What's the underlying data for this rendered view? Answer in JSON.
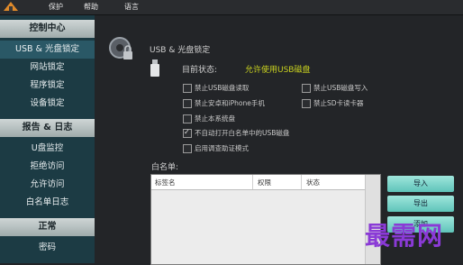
{
  "menu": {
    "items": [
      "保护",
      "帮助",
      "语言"
    ]
  },
  "sidebar": {
    "sections": [
      {
        "title": "控制中心",
        "items": [
          "USB & 光盘锁定",
          "网站锁定",
          "程序锁定",
          "设备锁定"
        ]
      },
      {
        "title": "报告 & 日志",
        "items": [
          "U盘监控",
          "拒绝访问",
          "允许访问",
          "白名单日志"
        ]
      },
      {
        "title": "正常",
        "items": [
          "密码"
        ]
      }
    ]
  },
  "main": {
    "title": "USB & 光盘锁定",
    "status_label": "目前状态:",
    "status_value": "允许使用USB磁盘",
    "options": [
      {
        "label": "禁止USB磁盘读取",
        "checked": false
      },
      {
        "label": "禁止USB磁盘写入",
        "checked": false
      },
      {
        "label": "禁止安卓和iPhone手机",
        "checked": false
      },
      {
        "label": "禁止SD卡读卡器",
        "checked": false
      },
      {
        "label": "禁止本系统盘",
        "checked": false
      },
      {
        "label": "不自动打开白名单中的USB磁盘",
        "checked": true
      },
      {
        "label": "启用调查助证模式",
        "checked": false
      }
    ],
    "whitelist_label": "白名单:",
    "table": {
      "headers": [
        "标签名",
        "权限",
        "状态"
      ]
    },
    "buttons": [
      "导入",
      "导出",
      "添加"
    ]
  },
  "watermark": "最需网",
  "colors": {
    "status_value": "#c9d21f",
    "button": "#6fd0c4",
    "section_header": "#b9c3c3",
    "sidebar": "#1c3b44",
    "watermark": "#8a3ad6"
  }
}
